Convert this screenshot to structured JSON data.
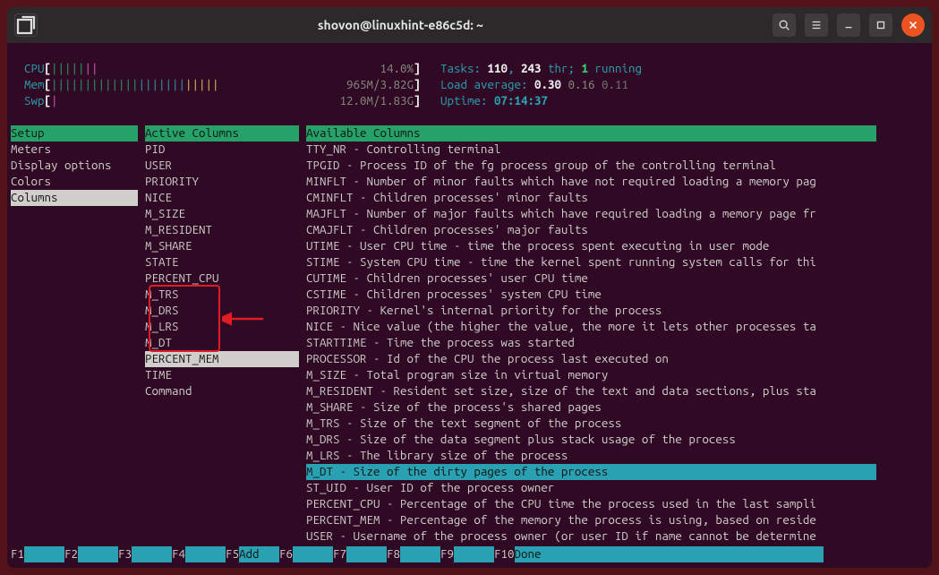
{
  "window_title": "shovon@linuxhint-e86c5d: ~",
  "meters": {
    "cpu_label": "CPU",
    "cpu_bars": "|||||||",
    "cpu_pct": "14.0%",
    "mem_label": "Mem",
    "mem_bars": "|||||||||||||||||||||||||",
    "mem_val": "965M/3.82G",
    "swp_label": "Swp",
    "swp_bars": "|",
    "swp_val": "12.0M/1.83G"
  },
  "stats": {
    "tasks_label": "Tasks:",
    "tasks_procs": "110",
    "tasks_sep": ", ",
    "tasks_thr": "243",
    "thr_label": " thr; ",
    "running_n": "1",
    "running_label": " running",
    "load_label": "Load average: ",
    "load1": "0.30",
    "load5": "0.16",
    "load15": "0.11",
    "uptime_label": "Uptime: ",
    "uptime_val": "07:14:37"
  },
  "headers": {
    "setup": "Setup",
    "active": "Active Columns",
    "available": "Available Columns"
  },
  "setup_menu": [
    "Meters",
    "Display options",
    "Colors",
    "Columns"
  ],
  "setup_selected_index": 3,
  "active_columns": [
    "PID",
    "USER",
    "PRIORITY",
    "NICE",
    "M_SIZE",
    "M_RESIDENT",
    "M_SHARE",
    "STATE",
    "PERCENT_CPU",
    "M_TRS",
    "M_DRS",
    "M_LRS",
    "M_DT",
    "PERCENT_MEM",
    "TIME",
    "Command"
  ],
  "active_selected_index": 13,
  "available_columns": [
    "TTY_NR - Controlling terminal",
    "TPGID - Process ID of the fg process group of the controlling terminal",
    "MINFLT - Number of minor faults which have not required loading a memory pag",
    "CMINFLT - Children processes' minor faults",
    "MAJFLT - Number of major faults which have required loading a memory page fr",
    "CMAJFLT - Children processes' major faults",
    "UTIME - User CPU time - time the process spent executing in user mode",
    "STIME - System CPU time - time the kernel spent running system calls for thi",
    "CUTIME - Children processes' user CPU time",
    "CSTIME - Children processes' system CPU time",
    "PRIORITY - Kernel's internal priority for the process",
    "NICE - Nice value (the higher the value, the more it lets other processes ta",
    "STARTTIME - Time the process was started",
    "PROCESSOR - Id of the CPU the process last executed on",
    "M_SIZE - Total program size in virtual memory",
    "M_RESIDENT - Resident set size, size of the text and data sections, plus sta",
    "M_SHARE - Size of the process's shared pages",
    "M_TRS - Size of the text segment of the process",
    "M_DRS - Size of the data segment plus stack usage of the process",
    "M_LRS - The library size of the process",
    "M_DT - Size of the dirty pages of the process",
    "ST_UID - User ID of the process owner",
    "PERCENT_CPU - Percentage of the CPU time the process used in the last sampli",
    "PERCENT_MEM - Percentage of the memory the process is using, based on reside",
    "USER - Username of the process owner (or user ID if name cannot be determine"
  ],
  "available_selected_index": 20,
  "fnkeys": [
    {
      "key": "F1",
      "label": "      "
    },
    {
      "key": "F2",
      "label": "      "
    },
    {
      "key": "F3",
      "label": "      "
    },
    {
      "key": "F4",
      "label": "      "
    },
    {
      "key": "F5",
      "label": "Add   "
    },
    {
      "key": "F6",
      "label": "      "
    },
    {
      "key": "F7",
      "label": "      "
    },
    {
      "key": "F8",
      "label": "      "
    },
    {
      "key": "F9",
      "label": "      "
    },
    {
      "key": "F10",
      "label": "Done  "
    }
  ]
}
